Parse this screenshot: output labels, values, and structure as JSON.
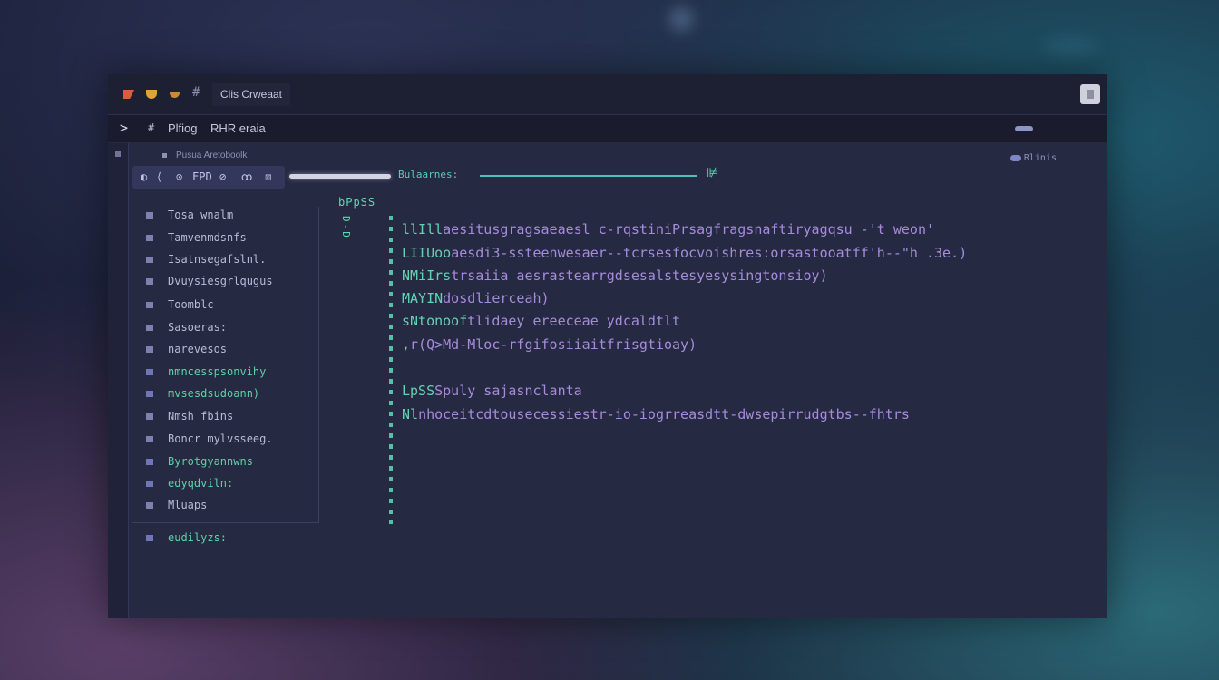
{
  "titlebar": {
    "hash": "#",
    "app_tab": "Clis Crweaat"
  },
  "menubar": {
    "chevron": ">",
    "icon": "#",
    "items": [
      "Plfiog",
      "RHR eraia"
    ]
  },
  "explorer": {
    "header": "Pusua Aretoboolk"
  },
  "toolbar": {
    "icons": [
      "◐",
      "⟨",
      "⊙",
      "FPD",
      "⊘",
      "ꝏ",
      "⧈"
    ]
  },
  "editor": {
    "slider_label": "Bulaarnes:",
    "progress_end": "⊯",
    "status_right": "Rlinis",
    "gutter_top": "bPpSS",
    "gutter_side": "D-D",
    "code_lines": [
      {
        "a": "llIll",
        "b": "aesitusgragsaeaesl   c-rqstiniPrsagfragsnaftiryagqsu -'t weon'"
      },
      {
        "a": "LIIUoo",
        "b": "aesdi3-ssteenwesaer--tcrsesfocvoishres:orsastooatff'h--\"h   .3e.)"
      },
      {
        "a": "NMiIrs",
        "b": "trsaiia  aesrastearrgdsesalstesyesysingtonsioy)"
      },
      {
        "a": "MAYIN",
        "b": "dosdlierceah)"
      },
      {
        "a": "sNtonoof",
        "b": "tlidaey ereeceae ydcaldtlt"
      },
      {
        "a": ",",
        "b": "r(Q>Md-Mloc-rfgifosiiaitfrisgtioay)"
      },
      {
        "a": "",
        "b": ""
      },
      {
        "a": "LpSS",
        "b": "Spuly  sajasnclanta"
      },
      {
        "a": "Nl",
        "b": "nhoceitcdtousecessiestr-io-iogrreasdtt-dwsepirrudgtbs--fhtrs"
      }
    ]
  },
  "file_tree": [
    {
      "label": "Tosa wnalm",
      "style": "plain"
    },
    {
      "label": "Tamvenmdsnfs",
      "style": "plain"
    },
    {
      "label": "Isatnsegafslnl.",
      "style": "plain"
    },
    {
      "label": "Dvuysiesgrlqugus",
      "style": "plain"
    },
    {
      "label": "Toomblc",
      "style": "plain"
    },
    {
      "label": "Sasoeras:",
      "style": "plain"
    },
    {
      "label": "narevesos",
      "style": "plain"
    },
    {
      "label": "nmncesspsonvihy",
      "style": "green"
    },
    {
      "label": "mvsesdsudoann)",
      "style": "green"
    },
    {
      "label": "Nmsh fbins",
      "style": "plain"
    },
    {
      "label": "Boncr mylvsseeg.",
      "style": "plain"
    },
    {
      "label": "Byrotgyannwns",
      "style": "green"
    },
    {
      "label": "edyqdviln:",
      "style": "green"
    },
    {
      "label": "Mluaps",
      "style": "plain"
    },
    {
      "label": "eudilyzs:",
      "style": "green"
    }
  ],
  "colors": {
    "window_bg": "#262942",
    "accent_green": "#63d1b3",
    "accent_purple": "#a68bdc"
  }
}
